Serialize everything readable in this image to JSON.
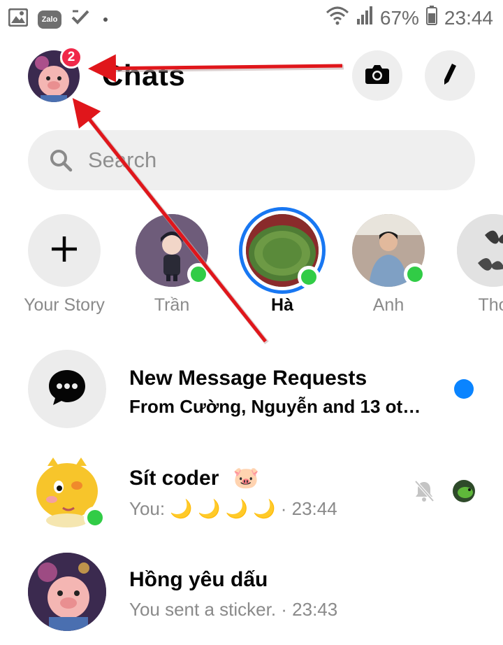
{
  "status_bar": {
    "battery": "67%",
    "time": "23:44",
    "zalo_label": "Zalo",
    "left_icons": [
      "gallery-icon",
      "zalo-icon",
      "check-icon",
      "dot-icon"
    ],
    "right_icons": [
      "wifi-icon",
      "signal-icon",
      "battery-icon"
    ]
  },
  "header": {
    "title": "Chats",
    "badge_count": "2",
    "buttons": [
      "camera-icon",
      "pencil-icon"
    ]
  },
  "search": {
    "placeholder": "Search"
  },
  "stories": [
    {
      "label": "Your Story",
      "type": "add"
    },
    {
      "label": "Trần",
      "online": true
    },
    {
      "label": "Hà",
      "online": true,
      "new_story": true
    },
    {
      "label": "Anh",
      "online": true
    },
    {
      "label": "Tho"
    }
  ],
  "chats": [
    {
      "name": "New Message Requests",
      "preview": "From Cường, Nguyễn and 13 oth…",
      "unread": true
    },
    {
      "name": "Sít coder",
      "name_emoji": "🐷",
      "preview_prefix": "You:",
      "preview_emoji": "🌙 🌙 🌙 🌙",
      "preview_time": "· 23:44",
      "muted": true,
      "online": true
    },
    {
      "name": "Hồng yêu dấu",
      "preview": "You sent a sticker. · 23:43"
    }
  ],
  "colors": {
    "accent": "#1877f2",
    "online": "#31cc46",
    "badge": "#f02849",
    "unread": "#0a84ff",
    "annotation_arrow": "#e0161b"
  }
}
